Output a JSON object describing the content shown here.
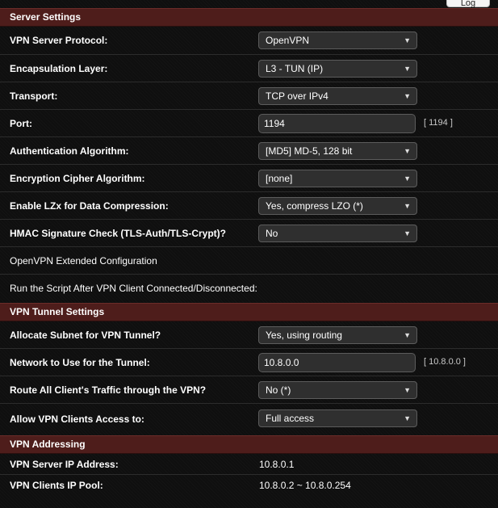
{
  "top": {
    "log_button": "Log"
  },
  "server_settings": {
    "title": "Server Settings",
    "protocol": {
      "label": "VPN Server Protocol:",
      "value": "OpenVPN"
    },
    "encapsulation": {
      "label": "Encapsulation Layer:",
      "value": "L3 - TUN (IP)"
    },
    "transport": {
      "label": "Transport:",
      "value": "TCP over IPv4"
    },
    "port": {
      "label": "Port:",
      "value": "1194",
      "hint": "[ 1194 ]"
    },
    "auth": {
      "label": "Authentication Algorithm:",
      "value": "[MD5] MD-5, 128 bit"
    },
    "cipher": {
      "label": "Encryption Cipher Algorithm:",
      "value": "[none]"
    },
    "lzx": {
      "label": "Enable LZx for Data Compression:",
      "value": "Yes, compress LZO (*)"
    },
    "hmac": {
      "label": "HMAC Signature Check (TLS-Auth/TLS-Crypt)?",
      "value": "No"
    },
    "extended": {
      "label": "OpenVPN Extended Configuration"
    },
    "script": {
      "label": "Run the Script After VPN Client Connected/Disconnected:"
    }
  },
  "tunnel_settings": {
    "title": "VPN Tunnel Settings",
    "allocate": {
      "label": "Allocate Subnet for VPN Tunnel?",
      "value": "Yes, using routing"
    },
    "network": {
      "label": "Network to Use for the Tunnel:",
      "value": "10.8.0.0",
      "hint": "[ 10.8.0.0 ]"
    },
    "route": {
      "label": "Route All Client's Traffic through the VPN?",
      "value": "No (*)"
    },
    "access": {
      "label": "Allow VPN Clients Access to:",
      "value": "Full access"
    }
  },
  "addressing": {
    "title": "VPN Addressing",
    "server_ip": {
      "label": "VPN Server IP Address:",
      "value": "10.8.0.1"
    },
    "pool": {
      "label": "VPN Clients IP Pool:",
      "value": "10.8.0.2 ~ 10.8.0.254"
    }
  }
}
